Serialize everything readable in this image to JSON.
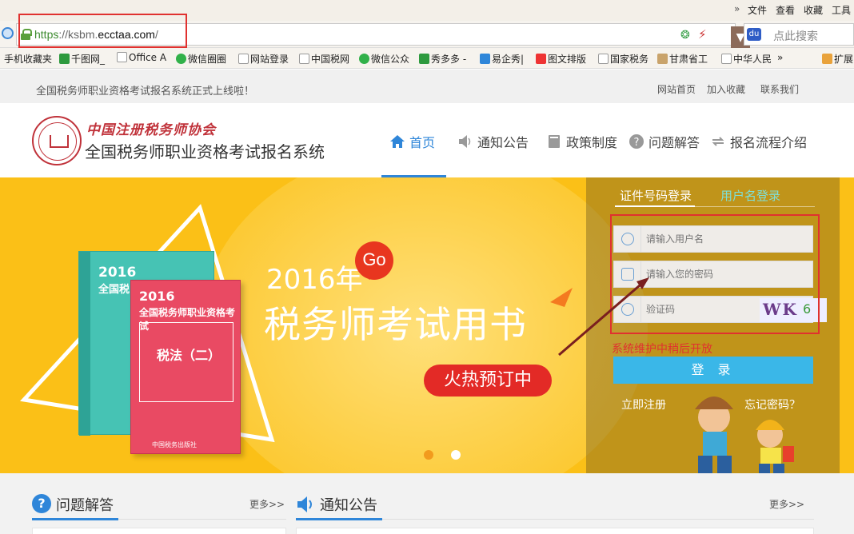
{
  "browser": {
    "menu": [
      "文件",
      "查看",
      "收藏",
      "工具"
    ],
    "menu_more": "»",
    "url": {
      "scheme": "https",
      "separator": "://",
      "host_prefix": "ksbm.",
      "domain": "ecctaa.com",
      "path": "/"
    },
    "search_placeholder": "点此搜索",
    "bookmarks": [
      "手机收藏夹",
      "千图网_",
      "Office A",
      "微信圈圈",
      "网站登录",
      "中国税网",
      "微信公众",
      "秀多多 -",
      "易企秀|",
      "图文排版",
      "国家税务",
      "甘肃省工",
      "中华人民"
    ],
    "bookmarks_more": "»",
    "extensions_label": "扩展"
  },
  "notice": {
    "text": "全国税务师职业资格考试报名系统正式上线啦！",
    "links": [
      "网站首页",
      "加入收藏",
      "联系我们"
    ]
  },
  "header": {
    "org_name": "中国注册税务师协会",
    "system_name": "全国税务师职业资格考试报名系统",
    "nav": [
      {
        "label": "首页",
        "icon": "home-icon",
        "active": true
      },
      {
        "label": "通知公告",
        "icon": "speaker-icon",
        "active": false
      },
      {
        "label": "政策制度",
        "icon": "book-icon",
        "active": false
      },
      {
        "label": "问题解答",
        "icon": "question-icon",
        "active": false
      },
      {
        "label": "报名流程介绍",
        "icon": "flow-icon",
        "active": false
      }
    ]
  },
  "banner": {
    "year": "2016年",
    "go": "Go",
    "title": "税务师考试用书",
    "button": "火热预订中",
    "book_green": {
      "year": "2016",
      "line": "全国税"
    },
    "book_red": {
      "year": "2016",
      "line": "全国税务师职业资格考试",
      "subject": "税法（二）",
      "publisher": "中国税务出版社"
    },
    "slides": 2,
    "active_slide": 1
  },
  "login": {
    "tabs": [
      "证件号码登录",
      "用户名登录"
    ],
    "username_placeholder": "请输入用户名",
    "password_placeholder": "请输入您的密码",
    "captcha_placeholder": "验证码",
    "captcha_text": "WK",
    "captcha_tail": "6",
    "maintenance": "系统维护中稍后开放",
    "login_button": "登 录",
    "register": "立即注册",
    "forgot": "忘记密码？"
  },
  "sections": [
    {
      "title": "问题解答",
      "icon": "question-icon",
      "more": "更多>>"
    },
    {
      "title": "通知公告",
      "icon": "speaker-icon",
      "more": "更多>>"
    }
  ],
  "colors": {
    "accent_blue": "#2f86d9",
    "banner_yellow": "#fbc017",
    "alert_red": "#e0312f",
    "login_button": "#3ab7e8"
  }
}
